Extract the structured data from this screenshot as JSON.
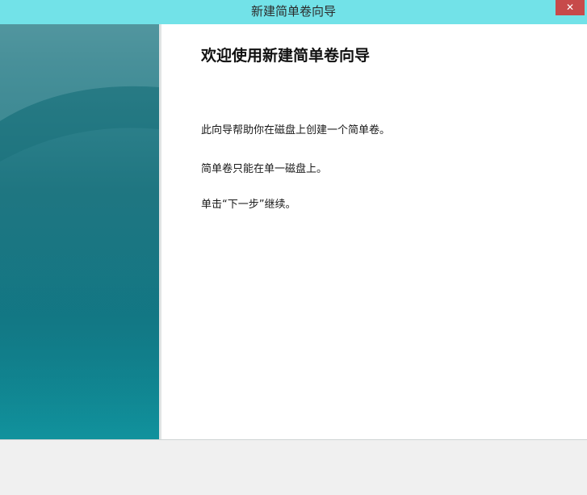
{
  "window": {
    "title": "新建简单卷向导",
    "close_glyph": "✕",
    "titlebar_color": "#72e2e8",
    "close_color": "#c74a4a"
  },
  "wizard": {
    "heading": "欢迎使用新建简单卷向导",
    "paragraphs": [
      "此向导帮助你在磁盘上创建一个简单卷。",
      "简单卷只能在单一磁盘上。",
      "单击“下一步”继续。"
    ]
  },
  "side_panel": {
    "accent_color": "#1f7681"
  }
}
